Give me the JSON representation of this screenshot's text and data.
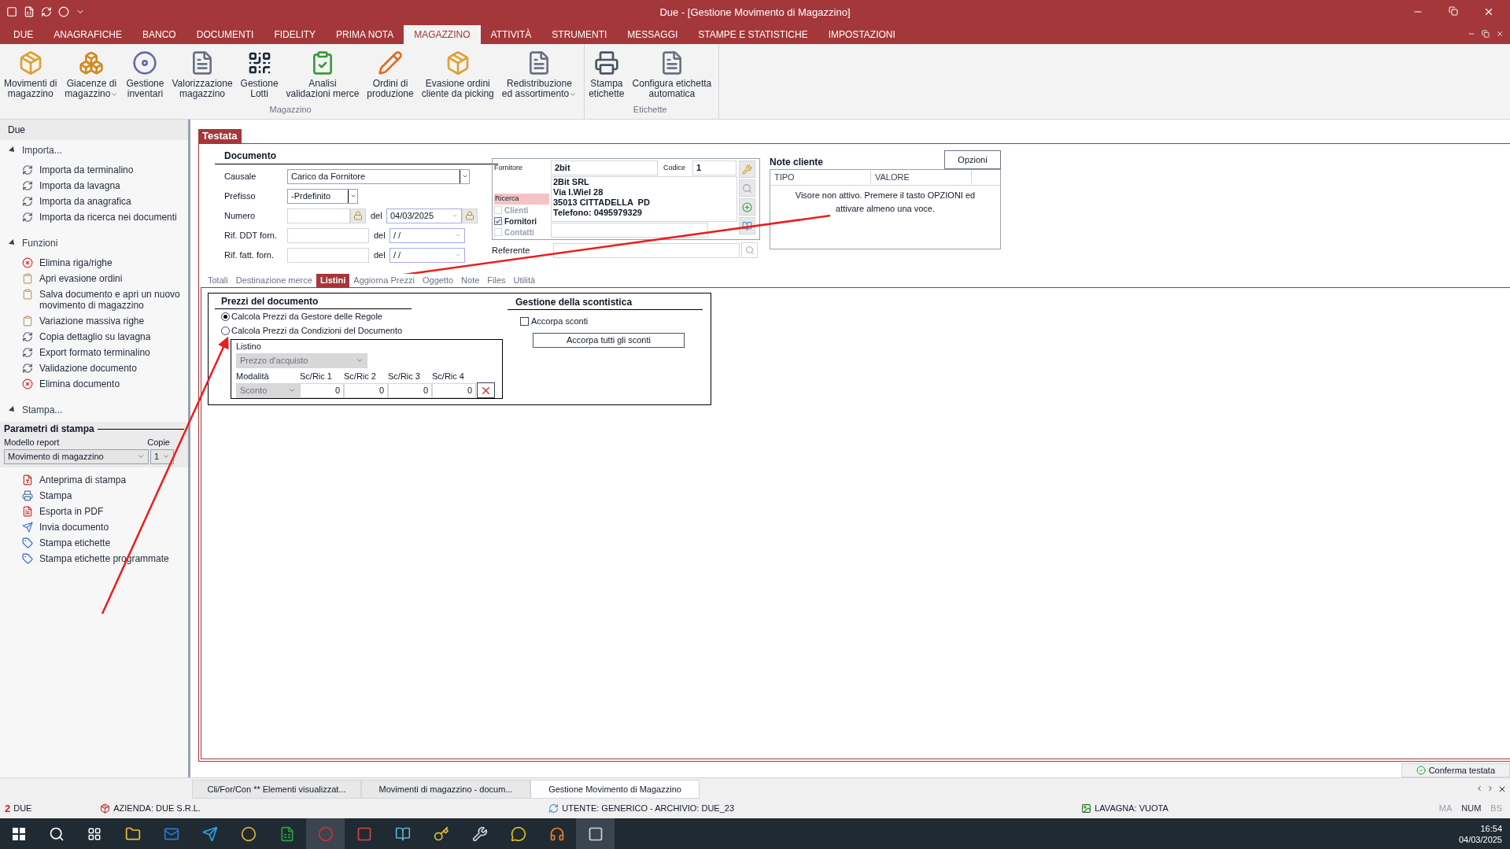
{
  "window": {
    "title": "Due - [Gestione Movimento di Magazzino]"
  },
  "menu_tabs": [
    {
      "label": "DUE",
      "selected": false
    },
    {
      "label": "ANAGRAFICHE",
      "selected": false
    },
    {
      "label": "BANCO",
      "selected": false
    },
    {
      "label": "DOCUMENTI",
      "selected": false
    },
    {
      "label": "FIDELITY",
      "selected": false
    },
    {
      "label": "PRIMA NOTA",
      "selected": false
    },
    {
      "label": "MAGAZZINO",
      "selected": true
    },
    {
      "label": "ATTIVITÀ",
      "selected": false
    },
    {
      "label": "STRUMENTI",
      "selected": false
    },
    {
      "label": "MESSAGGI",
      "selected": false
    },
    {
      "label": "STAMPE E STATISTICHE",
      "selected": false
    },
    {
      "label": "IMPOSTAZIONI",
      "selected": false
    }
  ],
  "ribbon": {
    "groups": [
      {
        "label": "Magazzino",
        "buttons": [
          {
            "kind": "box",
            "lines": [
              "Movimenti di",
              "magazzino"
            ],
            "dropdown": false
          },
          {
            "kind": "boxes",
            "lines": [
              "Giacenze di",
              "magazzino"
            ],
            "dropdown": true
          },
          {
            "kind": "disc",
            "lines": [
              "Gestione",
              "inventari"
            ],
            "dropdown": false
          },
          {
            "kind": "document",
            "lines": [
              "Valorizzazione",
              "magazzino"
            ],
            "dropdown": false
          },
          {
            "kind": "qr",
            "lines": [
              "Gestione",
              "Lotti"
            ],
            "dropdown": false
          },
          {
            "kind": "check",
            "lines": [
              "Analisi",
              "validazioni merce"
            ],
            "dropdown": false
          },
          {
            "kind": "pencil",
            "lines": [
              "Ordini di",
              "produzione"
            ],
            "dropdown": false
          },
          {
            "kind": "box",
            "lines": [
              "Evasione ordini",
              "cliente da picking"
            ],
            "dropdown": false
          },
          {
            "kind": "document",
            "lines": [
              "Redistribuzione",
              "ed assortimento"
            ],
            "dropdown": true
          }
        ]
      },
      {
        "label": "Etichette",
        "buttons": [
          {
            "kind": "printer",
            "lines": [
              "Stampa",
              "etichette"
            ],
            "dropdown": false
          },
          {
            "kind": "document",
            "lines": [
              "Configura etichetta",
              "automatica"
            ],
            "dropdown": false
          }
        ]
      }
    ]
  },
  "sidebar": {
    "header": "Due",
    "sections": [
      {
        "title": "Importa...",
        "expanded": true,
        "items": [
          {
            "kind": "gear",
            "lines": [
              "Importa da terminalino"
            ]
          },
          {
            "kind": "gear",
            "lines": [
              "Importa da lavagna"
            ]
          },
          {
            "kind": "gear",
            "lines": [
              "Importa da anagrafica"
            ]
          },
          {
            "kind": "gear",
            "lines": [
              "Importa da ricerca nei documenti"
            ]
          }
        ]
      },
      {
        "title": "Funzioni",
        "expanded": true,
        "items": [
          {
            "kind": "delete",
            "lines": [
              "Elimina riga/righe"
            ]
          },
          {
            "kind": "clipboard",
            "lines": [
              "Apri evasione ordini"
            ]
          },
          {
            "kind": "clipboard",
            "lines": [
              "Salva documento e apri un nuovo",
              "movimento di magazzino"
            ]
          },
          {
            "kind": "clipboard",
            "lines": [
              "Variazione massiva righe"
            ]
          },
          {
            "kind": "gear",
            "lines": [
              "Copia dettaglio su lavagna"
            ]
          },
          {
            "kind": "gear",
            "lines": [
              "Export formato terminalino"
            ]
          },
          {
            "kind": "gear",
            "lines": [
              "Validazione documento"
            ]
          },
          {
            "kind": "delete",
            "lines": [
              "Elimina documento"
            ]
          }
        ]
      },
      {
        "title": "Stampa...",
        "expanded": true
      }
    ],
    "print_params": {
      "title": "Parametri di stampa",
      "model_label": "Modello report",
      "model_value": "Movimento di magazzino",
      "copies_label": "Copie",
      "copies_value": "1"
    },
    "print_items": [
      {
        "kind": "preview",
        "lines": [
          "Anteprima di stampa"
        ]
      },
      {
        "kind": "printer",
        "lines": [
          "Stampa"
        ]
      },
      {
        "kind": "pdf",
        "lines": [
          "Esporta in PDF"
        ]
      },
      {
        "kind": "send",
        "lines": [
          "Invia documento"
        ]
      },
      {
        "kind": "label",
        "lines": [
          "Stampa etichette"
        ]
      },
      {
        "kind": "label",
        "lines": [
          "Stampa etichette programmate"
        ]
      }
    ]
  },
  "form_tab": "Testata",
  "document": {
    "title": "Documento",
    "rows": [
      {
        "label": "Causale",
        "kind": "combo",
        "value": "Carico da Fornitore"
      },
      {
        "label": "Prefisso",
        "kind": "combo",
        "value": "-Prdefinito"
      },
      {
        "label": "Numero",
        "kind": "dated",
        "locked": true,
        "date_label": "del",
        "date": "04/03/2025"
      },
      {
        "label": "Rif. DDT forn.",
        "kind": "dated",
        "locked": false,
        "date_label": "del",
        "date": " / /"
      },
      {
        "label": "Rif. fatt. forn.",
        "kind": "dated",
        "locked": false,
        "date_label": "del",
        "date": " / /"
      }
    ]
  },
  "supplier": {
    "label": "Fornitore",
    "name": "2bit",
    "code_label": "Codice",
    "code": "1",
    "address_lines": [
      "2Bit SRL",
      "Via I.Wiel 28",
      "35013 CITTADELLA  PD",
      "Telefono: 0495979329"
    ],
    "search_label": "Ricerca",
    "filters": [
      {
        "label": "Clienti",
        "checked": false,
        "disabled": true
      },
      {
        "label": "Fornitori",
        "checked": true,
        "disabled": false
      },
      {
        "label": "Contatti",
        "checked": false,
        "disabled": true
      }
    ],
    "referent_label": "Referente"
  },
  "notes": {
    "title": "Note cliente",
    "button": "Opzioni",
    "columns": [
      "TIPO",
      "VALORE"
    ],
    "message": "Visore non attivo. Premere il tasto OPZIONI ed attivare almeno una voce."
  },
  "sub_tabs": [
    {
      "label": "Totali",
      "selected": false
    },
    {
      "label": "Destinazione merce",
      "selected": false
    },
    {
      "label": "Listini",
      "selected": true
    },
    {
      "label": "Aggiorna Prezzi",
      "selected": false
    },
    {
      "label": "Oggetto",
      "selected": false
    },
    {
      "label": "Note",
      "selected": false
    },
    {
      "label": "Files",
      "selected": false
    },
    {
      "label": "Utilità",
      "selected": false
    }
  ],
  "prices": {
    "title": "Prezzi del documento",
    "options": [
      {
        "label": "Calcola Prezzi da Gestore delle Regole",
        "selected": true
      },
      {
        "label": "Calcola Prezzi da Condizioni del Documento",
        "selected": false
      }
    ],
    "listino_label": "Listino",
    "listino_value": "Prezzo d'acquisto",
    "mode_label": "Modalità",
    "mode_value": "Sconto",
    "discount_columns": [
      "Sc/Ric 1",
      "Sc/Ric 2",
      "Sc/Ric 3",
      "Sc/Ric 4"
    ],
    "discount_values": [
      "0",
      "0",
      "0",
      "0"
    ]
  },
  "discounts": {
    "title": "Gestione della scontistica",
    "checkbox_label": "Accorpa sconti",
    "checked": false,
    "button": "Accorpa tutti gli sconti"
  },
  "confirm_button": "Conferma testata",
  "doc_tabs": [
    {
      "label": "Cli/For/Con ** Elementi visualizzat...",
      "selected": false
    },
    {
      "label": "Movimenti di magazzino - docum...",
      "selected": false
    },
    {
      "label": "Gestione Movimento di Magazzino",
      "selected": true
    }
  ],
  "status_bar": {
    "logo": "2",
    "app": "DUE",
    "company": "AZIENDA: DUE S.R.L.",
    "user": "UTENTE: GENERICO - ARCHIVIO: DUE_23",
    "board": "LAVAGNA: VUOTA",
    "indicators": [
      {
        "label": "MA",
        "on": false
      },
      {
        "label": "NUM",
        "on": true
      },
      {
        "label": "BS",
        "on": false
      }
    ]
  },
  "taskbar": {
    "time": "16:54",
    "date": "04/03/2025"
  }
}
